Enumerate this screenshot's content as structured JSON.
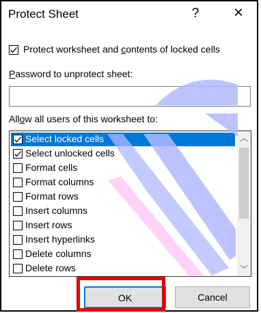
{
  "dialog": {
    "title": "Protect Sheet",
    "help_label": "?",
    "close_label": "×",
    "protect_checkbox": {
      "checked": true,
      "label_pre": "Protect worksheet and ",
      "label_ul": "c",
      "label_post": "ontents of locked cells"
    },
    "password_label_ul": "P",
    "password_label_rest": "assword to unprotect sheet:",
    "password_value": "",
    "allow_label_pre": "All",
    "allow_label_ul": "o",
    "allow_label_post": "w all users of this worksheet to:",
    "permissions": [
      {
        "label": "Select locked cells",
        "checked": true,
        "selected": true
      },
      {
        "label": "Select unlocked cells",
        "checked": true,
        "selected": false
      },
      {
        "label": "Format cells",
        "checked": false,
        "selected": false
      },
      {
        "label": "Format columns",
        "checked": false,
        "selected": false
      },
      {
        "label": "Format rows",
        "checked": false,
        "selected": false
      },
      {
        "label": "Insert columns",
        "checked": false,
        "selected": false
      },
      {
        "label": "Insert rows",
        "checked": false,
        "selected": false
      },
      {
        "label": "Insert hyperlinks",
        "checked": false,
        "selected": false
      },
      {
        "label": "Delete columns",
        "checked": false,
        "selected": false
      },
      {
        "label": "Delete rows",
        "checked": false,
        "selected": false
      }
    ],
    "ok_label": "OK",
    "cancel_label": "Cancel",
    "colors": {
      "accent": "#0078d7",
      "highlight": "#e00000",
      "overlay_blue": "#b0b8ff",
      "overlay_pink": "#ffc8f5"
    }
  }
}
